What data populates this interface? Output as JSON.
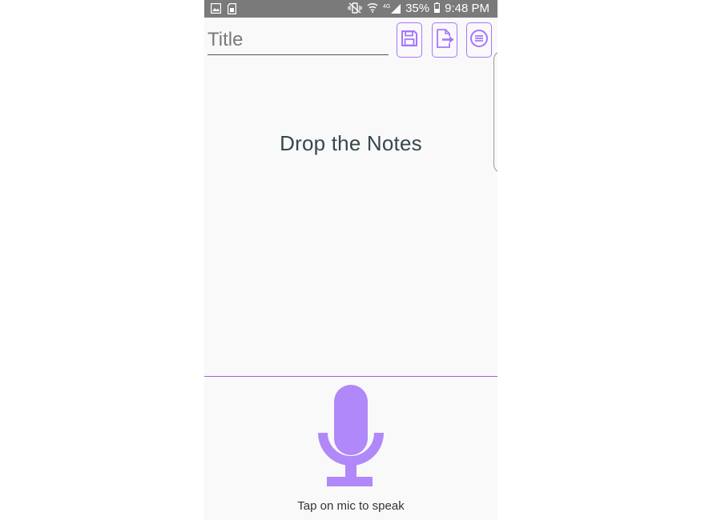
{
  "status_bar": {
    "battery_percent": "35%",
    "time": "9:48 PM",
    "network_label": "4G",
    "left_icons": [
      "image-icon",
      "sim-icon"
    ],
    "right_icons": [
      "mute-vibrate-icon",
      "wifi-icon",
      "signal-icon",
      "battery-icon"
    ]
  },
  "toolbar": {
    "title_placeholder": "Title",
    "title_value": "",
    "buttons": [
      {
        "icon": "save-icon"
      },
      {
        "icon": "export-file-icon"
      },
      {
        "icon": "list-menu-icon"
      }
    ]
  },
  "notes": {
    "placeholder": "Drop the Notes"
  },
  "voice": {
    "icon": "microphone-icon",
    "caption": "Tap on mic to speak"
  },
  "colors": {
    "accent": "#a675ff",
    "mic": "#b088f9",
    "divider": "#b35bd8",
    "status_bar": "#7a7a7a",
    "background": "#f9f9f9",
    "notes_text": "#37474f"
  }
}
